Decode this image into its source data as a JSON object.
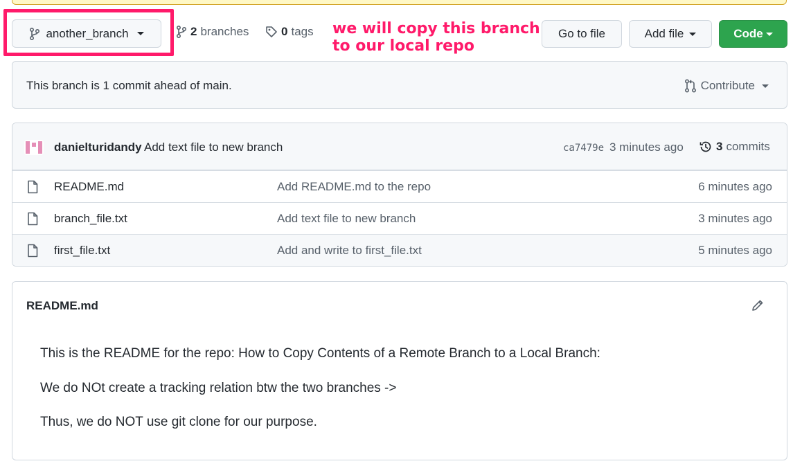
{
  "branch": {
    "name": "another_branch"
  },
  "meta": {
    "branches_count": "2",
    "branches_label": "branches",
    "tags_count": "0",
    "tags_label": "tags"
  },
  "annotation": {
    "line1": "we will copy this branch",
    "line2": "to our local repo"
  },
  "toolbar": {
    "goto_label": "Go to file",
    "addfile_label": "Add file",
    "code_label": "Code"
  },
  "ahead": {
    "text": "This branch is 1 commit ahead of main.",
    "contribute_label": "Contribute"
  },
  "commit": {
    "author": "danielturidandy",
    "message": "Add text file to new branch",
    "sha": "ca7479e",
    "time": "3 minutes ago",
    "count": "3",
    "count_label": "commits"
  },
  "files": [
    {
      "name": "README.md",
      "message": "Add README.md to the repo",
      "time": "6 minutes ago"
    },
    {
      "name": "branch_file.txt",
      "message": "Add text file to new branch",
      "time": "3 minutes ago"
    },
    {
      "name": "first_file.txt",
      "message": "Add and write to first_file.txt",
      "time": "5 minutes ago"
    }
  ],
  "readme": {
    "title": "README.md",
    "paragraphs": [
      "This is the README for the repo: How to Copy Contents of a Remote Branch to a Local Branch:",
      "We do NOt create a tracking relation btw the two branches ->",
      "Thus, we do NOT use git clone for our purpose."
    ]
  },
  "colors": {
    "accent_annotation": "#ff1a6a",
    "code_button": "#2da44e"
  }
}
